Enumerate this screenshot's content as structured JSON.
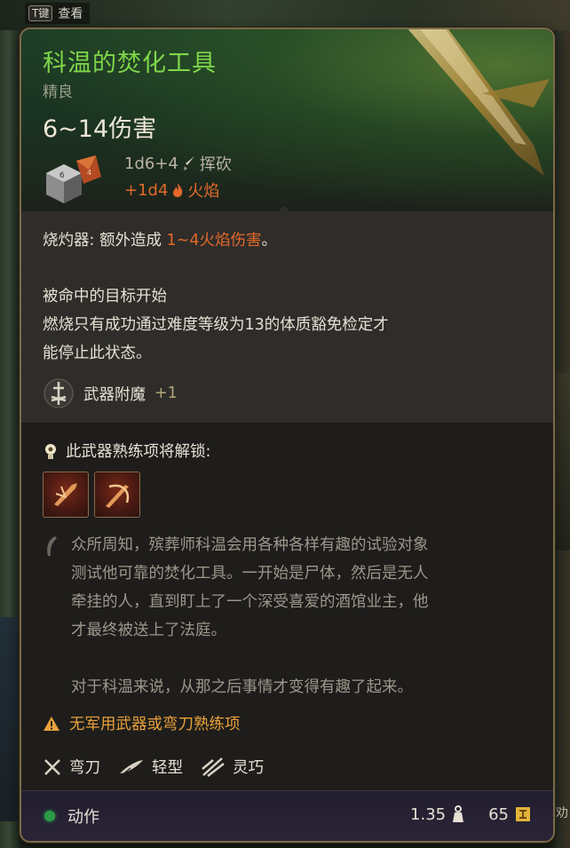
{
  "hint": {
    "key": "T键",
    "label": "查看"
  },
  "corner_label": "劝",
  "item": {
    "name": "科温的焚化工具",
    "rarity": "精良",
    "damage": "6~14伤害",
    "base_roll": "1d6+4",
    "damage_type": "挥砍",
    "bonus_roll": "+1d4",
    "bonus_type": "火焰"
  },
  "effect": {
    "name": "烧灼器:",
    "text_before": " 额外造成 ",
    "fire_text": "1~4火焰伤害",
    "text_after": "。",
    "line1": "被命中的目标开始",
    "line2": "燃烧只有成功通过难度等级为13的体质豁免检定才",
    "line3": "能停止此状态。"
  },
  "enchant": {
    "label": "武器附魔",
    "value": "+1"
  },
  "proficiency": {
    "header": "此武器熟练项将解锁:"
  },
  "lore": {
    "para1_lines": [
      "众所周知，殡葬师科温会用各种各样有趣的试验对象",
      "测试他可靠的焚化工具。一开始是尸体，然后是无人",
      "牵挂的人，直到盯上了一个深受喜爱的酒馆业主，他",
      "才最终被送上了法庭。"
    ],
    "para2": "对于科温来说，从那之后事情才变得有趣了起来。"
  },
  "warning": "无军用武器或弯刀熟练项",
  "properties": [
    "弯刀",
    "轻型",
    "灵巧"
  ],
  "footer": {
    "action": "动作",
    "weight": "1.35",
    "value": "65"
  },
  "colors": {
    "title": "#7fd64a",
    "fire": "#e2682a",
    "warning": "#e8a13a",
    "action_dot": "#2c9c4a"
  }
}
